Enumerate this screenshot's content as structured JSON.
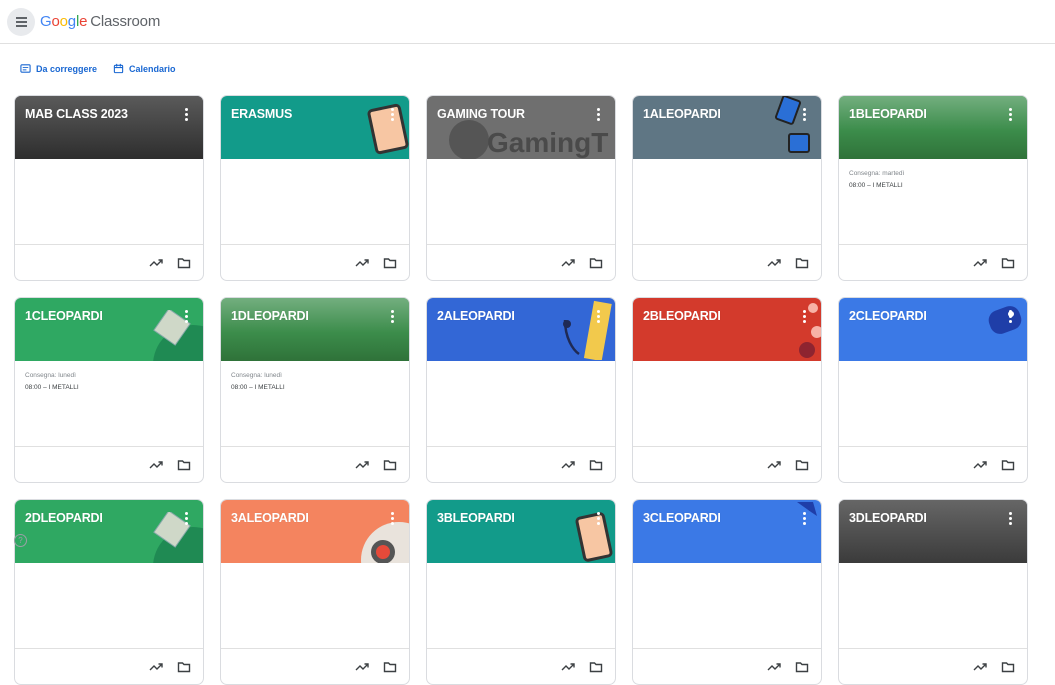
{
  "app": {
    "brand_letters": [
      "G",
      "o",
      "o",
      "g",
      "l",
      "e"
    ],
    "product": "Classroom"
  },
  "subnav": {
    "to_review": "Da correggere",
    "calendar": "Calendario"
  },
  "cards": [
    {
      "title": "MAB CLASS 2023",
      "color": "#3d3d3d",
      "due": "",
      "item": ""
    },
    {
      "title": "ERASMUS",
      "color": "#129b8a",
      "due": "",
      "item": ""
    },
    {
      "title": "GAMING TOUR",
      "color": "#6f6f6f",
      "due": "",
      "item": ""
    },
    {
      "title": "1ALEOPARDI",
      "color": "#5f7684",
      "due": "",
      "item": ""
    },
    {
      "title": "1BLEOPARDI",
      "color": "#2f8a3f",
      "due": "Consegna: martedì",
      "item": "08:00 – I METALLI"
    },
    {
      "title": "1CLEOPARDI",
      "color": "#2fa862",
      "due": "Consegna: lunedì",
      "item": "08:00 – I METALLI"
    },
    {
      "title": "1DLEOPARDI",
      "color": "#2f8a3f",
      "due": "Consegna: lunedì",
      "item": "08:00 – I METALLI"
    },
    {
      "title": "2ALEOPARDI",
      "color": "#3367d6",
      "due": "",
      "item": ""
    },
    {
      "title": "2BLEOPARDI",
      "color": "#d33a2c",
      "due": "",
      "item": ""
    },
    {
      "title": "2CLEOPARDI",
      "color": "#3b79e6",
      "due": "",
      "item": ""
    },
    {
      "title": "2DLEOPARDI",
      "color": "#2fa862",
      "due": "",
      "item": ""
    },
    {
      "title": "3ALEOPARDI",
      "color": "#f4845f",
      "due": "",
      "item": ""
    },
    {
      "title": "3BLEOPARDI",
      "color": "#129b8a",
      "due": "",
      "item": ""
    },
    {
      "title": "3CLEOPARDI",
      "color": "#3b79e6",
      "due": "",
      "item": ""
    },
    {
      "title": "3DLEOPARDI",
      "color": "#4a4a4a",
      "due": "",
      "item": ""
    }
  ],
  "banner_text": {
    "gaming": "GamingT"
  },
  "footer_icons": [
    "trending-up-icon",
    "folder-icon"
  ],
  "help": "?"
}
